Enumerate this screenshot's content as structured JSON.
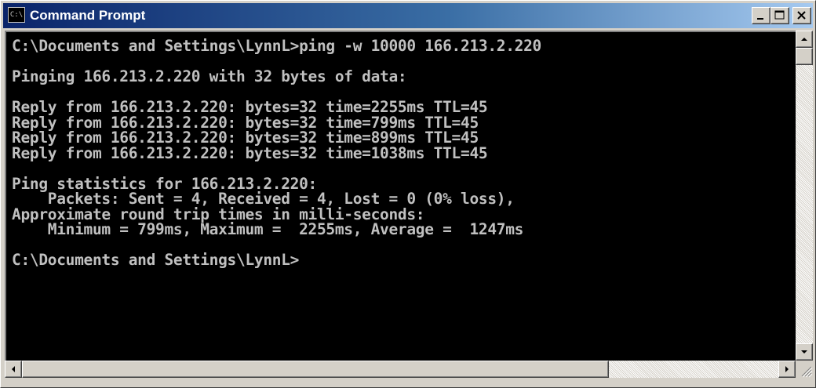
{
  "window": {
    "title": "Command Prompt",
    "icon_name": "console-icon",
    "icon_text": "C:\\"
  },
  "console": {
    "lines": [
      "C:\\Documents and Settings\\LynnL>ping -w 10000 166.213.2.220",
      "",
      "Pinging 166.213.2.220 with 32 bytes of data:",
      "",
      "Reply from 166.213.2.220: bytes=32 time=2255ms TTL=45",
      "Reply from 166.213.2.220: bytes=32 time=799ms TTL=45",
      "Reply from 166.213.2.220: bytes=32 time=899ms TTL=45",
      "Reply from 166.213.2.220: bytes=32 time=1038ms TTL=45",
      "",
      "Ping statistics for 166.213.2.220:",
      "    Packets: Sent = 4, Received = 4, Lost = 0 (0% loss),",
      "Approximate round trip times in milli-seconds:",
      "    Minimum = 799ms, Maximum =  2255ms, Average =  1247ms",
      "",
      "C:\\Documents and Settings\\LynnL>"
    ]
  },
  "colors": {
    "titlebar_start": "#0a246a",
    "titlebar_end": "#a6caf0",
    "console_bg": "#000000",
    "console_fg": "#c0c0c0"
  }
}
